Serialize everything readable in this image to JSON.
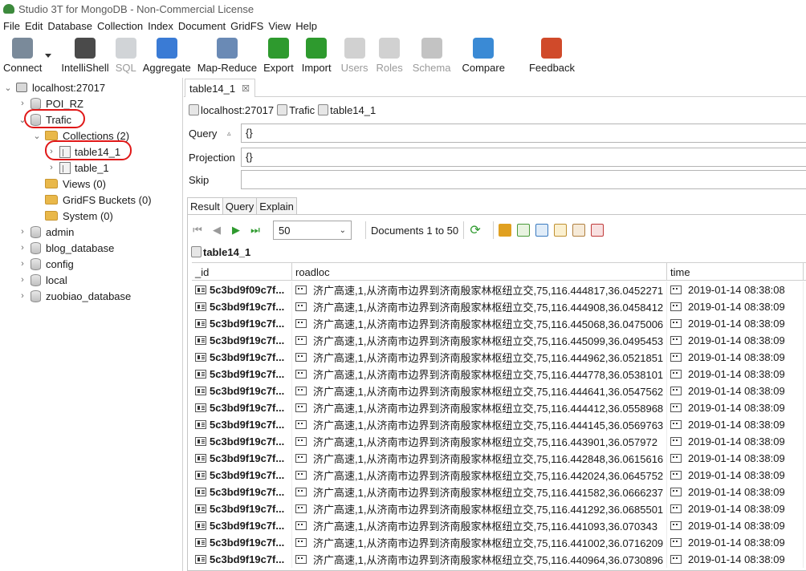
{
  "window": {
    "title": "Studio 3T for MongoDB - Non-Commercial License"
  },
  "menu": [
    "File",
    "Edit",
    "Database",
    "Collection",
    "Index",
    "Document",
    "GridFS",
    "View",
    "Help"
  ],
  "toolbar": [
    {
      "label": "Connect",
      "icon": "connect-icon",
      "color": "#7a8a9a",
      "enabled": true
    },
    {
      "label": "IntelliShell",
      "icon": "shell-icon",
      "color": "#4a4a4a",
      "enabled": true
    },
    {
      "label": "SQL",
      "icon": "sql-icon",
      "color": "#9aa0a6",
      "enabled": false
    },
    {
      "label": "Aggregate",
      "icon": "aggregate-icon",
      "color": "#3a7bd5",
      "enabled": true
    },
    {
      "label": "Map-Reduce",
      "icon": "map-reduce-icon",
      "color": "#6a8ab5",
      "enabled": true
    },
    {
      "label": "Export",
      "icon": "export-icon",
      "color": "#2e9a2e",
      "enabled": true
    },
    {
      "label": "Import",
      "icon": "import-icon",
      "color": "#2e9a2e",
      "enabled": true
    },
    {
      "label": "Users",
      "icon": "users-icon",
      "color": "#9a9a9a",
      "enabled": false
    },
    {
      "label": "Roles",
      "icon": "roles-icon",
      "color": "#9a9a9a",
      "enabled": false
    },
    {
      "label": "Schema",
      "icon": "schema-icon",
      "color": "#7a7a7a",
      "enabled": false
    },
    {
      "label": "Compare",
      "icon": "compare-icon",
      "color": "#3a8ad5",
      "enabled": true
    },
    {
      "label": "Feedback",
      "icon": "feedback-icon",
      "color": "#d04a2a",
      "enabled": true
    }
  ],
  "tree": {
    "connection": "localhost:27017",
    "databases_before": [
      "POI_RZ"
    ],
    "active_db": "Trafic",
    "collections_folder": "Collections (2)",
    "collections": [
      "table14_1",
      "table_1"
    ],
    "views_folder": "Views (0)",
    "gridfs_folder": "GridFS Buckets (0)",
    "system_folder": "System (0)",
    "databases_after": [
      "admin",
      "blog_database",
      "config",
      "local",
      "zuobiao_database"
    ]
  },
  "tab": {
    "label": "table14_1"
  },
  "breadcrumb": [
    "localhost:27017",
    "Trafic",
    "table14_1"
  ],
  "query": {
    "label": "Query",
    "value": "{}"
  },
  "projection": {
    "label": "Projection",
    "value": "{}"
  },
  "skip": {
    "label": "Skip",
    "value": ""
  },
  "result_tabs": [
    "Result",
    "Query",
    "Explain"
  ],
  "page_size": "50",
  "doc_count": "Documents 1 to 50",
  "collection_title": "table14_1",
  "columns": [
    "_id",
    "roadloc",
    "time"
  ],
  "rows": [
    {
      "id": "5c3bd9f09c7f...",
      "roadloc": "济广高速,1,从济南市边界到济南殷家林枢纽立交,75,116.444817,36.0452271",
      "time": "2019-01-14 08:38:08"
    },
    {
      "id": "5c3bd9f19c7f...",
      "roadloc": "济广高速,1,从济南市边界到济南殷家林枢纽立交,75,116.444908,36.0458412",
      "time": "2019-01-14 08:38:09"
    },
    {
      "id": "5c3bd9f19c7f...",
      "roadloc": "济广高速,1,从济南市边界到济南殷家林枢纽立交,75,116.445068,36.0475006",
      "time": "2019-01-14 08:38:09"
    },
    {
      "id": "5c3bd9f19c7f...",
      "roadloc": "济广高速,1,从济南市边界到济南殷家林枢纽立交,75,116.445099,36.0495453",
      "time": "2019-01-14 08:38:09"
    },
    {
      "id": "5c3bd9f19c7f...",
      "roadloc": "济广高速,1,从济南市边界到济南殷家林枢纽立交,75,116.444962,36.0521851",
      "time": "2019-01-14 08:38:09"
    },
    {
      "id": "5c3bd9f19c7f...",
      "roadloc": "济广高速,1,从济南市边界到济南殷家林枢纽立交,75,116.444778,36.0538101",
      "time": "2019-01-14 08:38:09"
    },
    {
      "id": "5c3bd9f19c7f...",
      "roadloc": "济广高速,1,从济南市边界到济南殷家林枢纽立交,75,116.444641,36.0547562",
      "time": "2019-01-14 08:38:09"
    },
    {
      "id": "5c3bd9f19c7f...",
      "roadloc": "济广高速,1,从济南市边界到济南殷家林枢纽立交,75,116.444412,36.0558968",
      "time": "2019-01-14 08:38:09"
    },
    {
      "id": "5c3bd9f19c7f...",
      "roadloc": "济广高速,1,从济南市边界到济南殷家林枢纽立交,75,116.444145,36.0569763",
      "time": "2019-01-14 08:38:09"
    },
    {
      "id": "5c3bd9f19c7f...",
      "roadloc": "济广高速,1,从济南市边界到济南殷家林枢纽立交,75,116.443901,36.057972",
      "time": "2019-01-14 08:38:09"
    },
    {
      "id": "5c3bd9f19c7f...",
      "roadloc": "济广高速,1,从济南市边界到济南殷家林枢纽立交,75,116.442848,36.0615616",
      "time": "2019-01-14 08:38:09"
    },
    {
      "id": "5c3bd9f19c7f...",
      "roadloc": "济广高速,1,从济南市边界到济南殷家林枢纽立交,75,116.442024,36.0645752",
      "time": "2019-01-14 08:38:09"
    },
    {
      "id": "5c3bd9f19c7f...",
      "roadloc": "济广高速,1,从济南市边界到济南殷家林枢纽立交,75,116.441582,36.0666237",
      "time": "2019-01-14 08:38:09"
    },
    {
      "id": "5c3bd9f19c7f...",
      "roadloc": "济广高速,1,从济南市边界到济南殷家林枢纽立交,75,116.441292,36.0685501",
      "time": "2019-01-14 08:38:09"
    },
    {
      "id": "5c3bd9f19c7f...",
      "roadloc": "济广高速,1,从济南市边界到济南殷家林枢纽立交,75,116.441093,36.070343",
      "time": "2019-01-14 08:38:09"
    },
    {
      "id": "5c3bd9f19c7f...",
      "roadloc": "济广高速,1,从济南市边界到济南殷家林枢纽立交,75,116.441002,36.0716209",
      "time": "2019-01-14 08:38:09"
    },
    {
      "id": "5c3bd9f19c7f...",
      "roadloc": "济广高速,1,从济南市边界到济南殷家林枢纽立交,75,116.440964,36.0730896",
      "time": "2019-01-14 08:38:09"
    }
  ]
}
